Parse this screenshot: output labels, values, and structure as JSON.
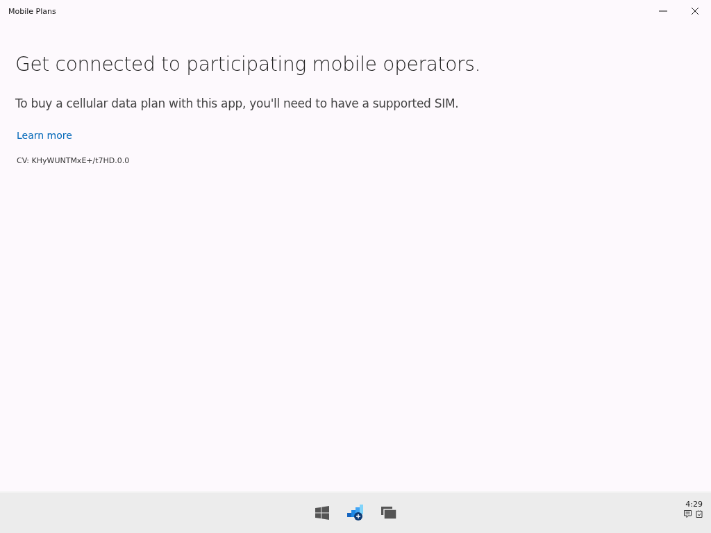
{
  "window": {
    "title": "Mobile Plans"
  },
  "content": {
    "heading": "Get connected to participating mobile operators.",
    "subtitle": "To buy a cellular data plan with this app, you'll need to have a supported SIM.",
    "link": "Learn more",
    "version": "CV: KHyWUNTMxE+/t7HD.0.0"
  },
  "taskbar": {
    "time": "4:29"
  }
}
